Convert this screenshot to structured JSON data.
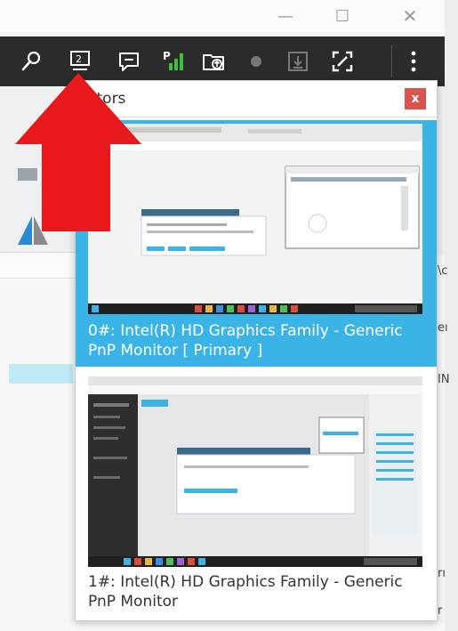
{
  "window": {
    "minimize_icon": "minimize-icon",
    "maximize_icon": "maximize-icon",
    "close_icon": "close-icon"
  },
  "toolbar": {
    "icons": [
      "wrench-icon",
      "monitor-select-icon",
      "chat-icon",
      "signal-quality-icon",
      "file-transfer-icon",
      "record-icon",
      "download-icon",
      "fullscreen-icon",
      "more-vertical-icon"
    ],
    "monitor_badge": "2",
    "signal_label": "P"
  },
  "popup": {
    "title": "nitors",
    "close_label": "x",
    "monitors": [
      {
        "label": "0#: Intel(R) HD Graphics Family - Generic PnP Monitor [ Primary ]",
        "selected": true
      },
      {
        "label": "1#: Intel(R) HD Graphics Family - Generic PnP Monitor",
        "selected": false
      }
    ]
  },
  "background": {
    "fragment_1": "\\c",
    "fragment_2": "eı",
    "fragment_3": "IN",
    "fragment_4": "rı",
    "fragment_5": "r"
  },
  "colors": {
    "toolbar_bg": "#2b2b2b",
    "selected_bg": "#3ab4e6",
    "close_button": "#d9534f",
    "annotation_arrow": "#e8181b"
  }
}
